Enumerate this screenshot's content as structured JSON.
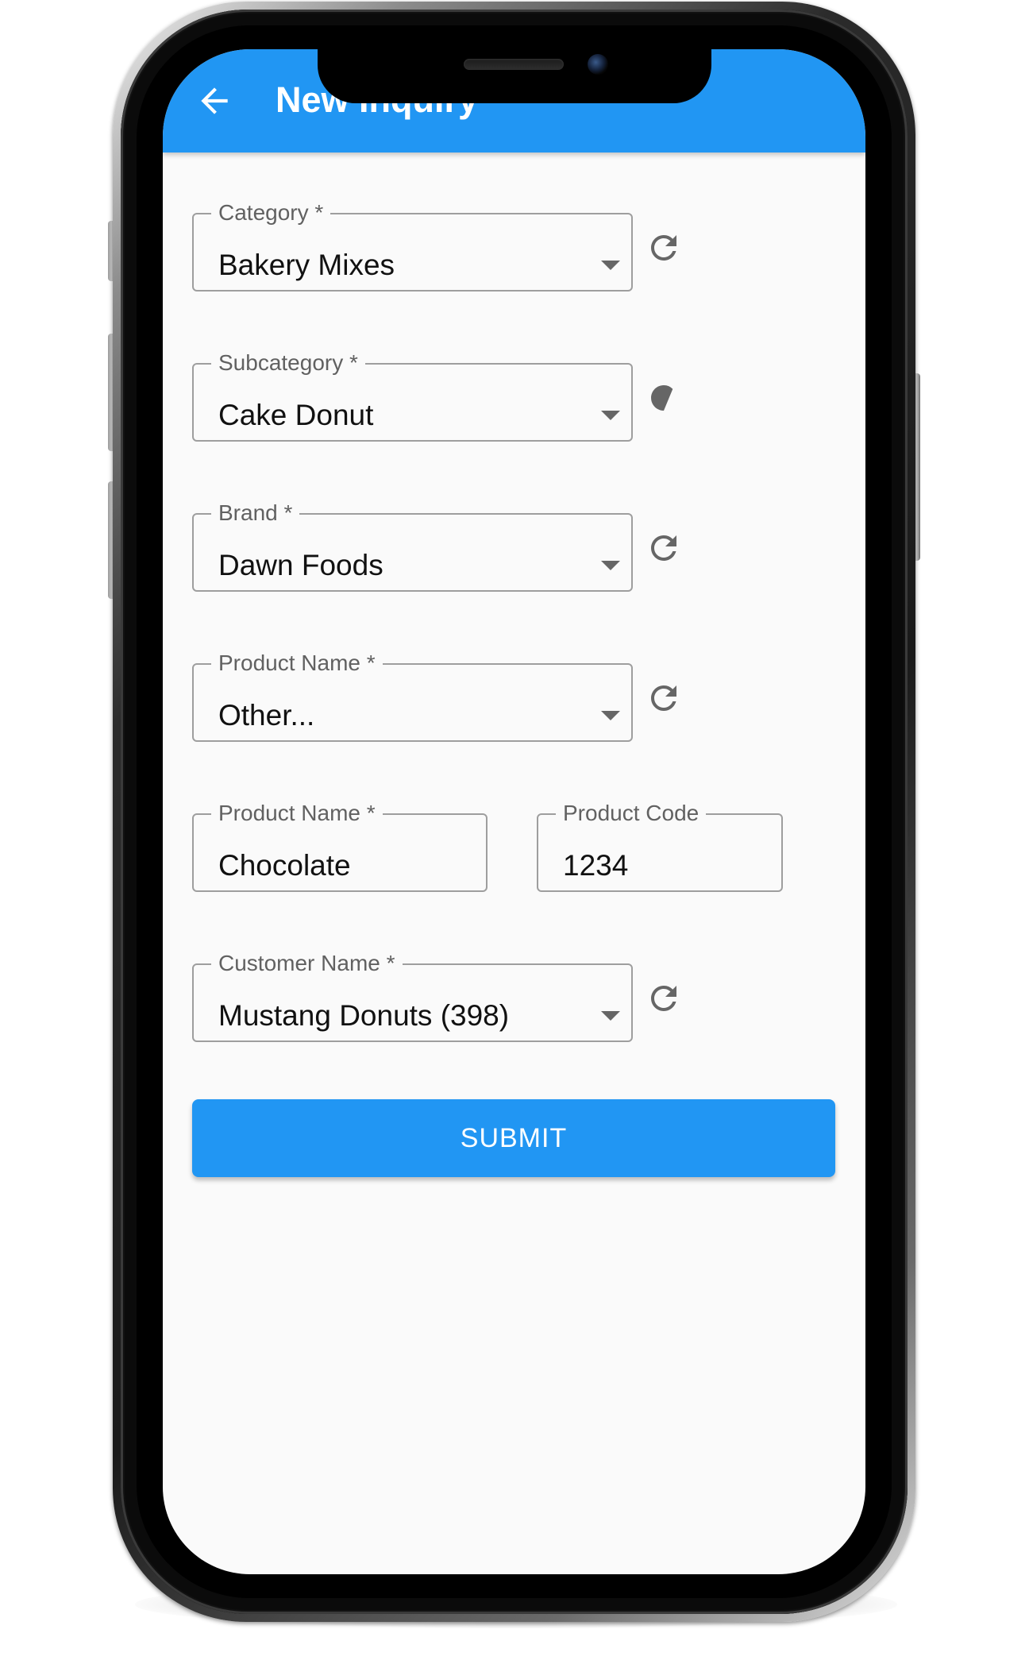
{
  "app_bar": {
    "title": "New Inquiry",
    "back_icon": "arrow-left-icon"
  },
  "colors": {
    "primary": "#2196f3",
    "background": "#fafafa",
    "outline": "#9e9e9e",
    "label": "#616161",
    "text": "#111111"
  },
  "form": {
    "category": {
      "label": "Category *",
      "value": "Bakery Mixes"
    },
    "subcategory": {
      "label": "Subcategory *",
      "value": "Cake Donut"
    },
    "brand": {
      "label": "Brand *",
      "value": "Dawn Foods"
    },
    "product_select": {
      "label": "Product Name *",
      "value": "Other..."
    },
    "product_name": {
      "label": "Product Name *",
      "value": "Chocolate"
    },
    "product_code": {
      "label": "Product Code",
      "value": "1234"
    },
    "customer": {
      "label": "Customer Name *",
      "value": "Mustang Donuts (398)"
    },
    "refresh_icon": "refresh-icon",
    "dropdown_icon": "arrow-drop-down-icon"
  },
  "submit": {
    "label": "SUBMIT"
  }
}
